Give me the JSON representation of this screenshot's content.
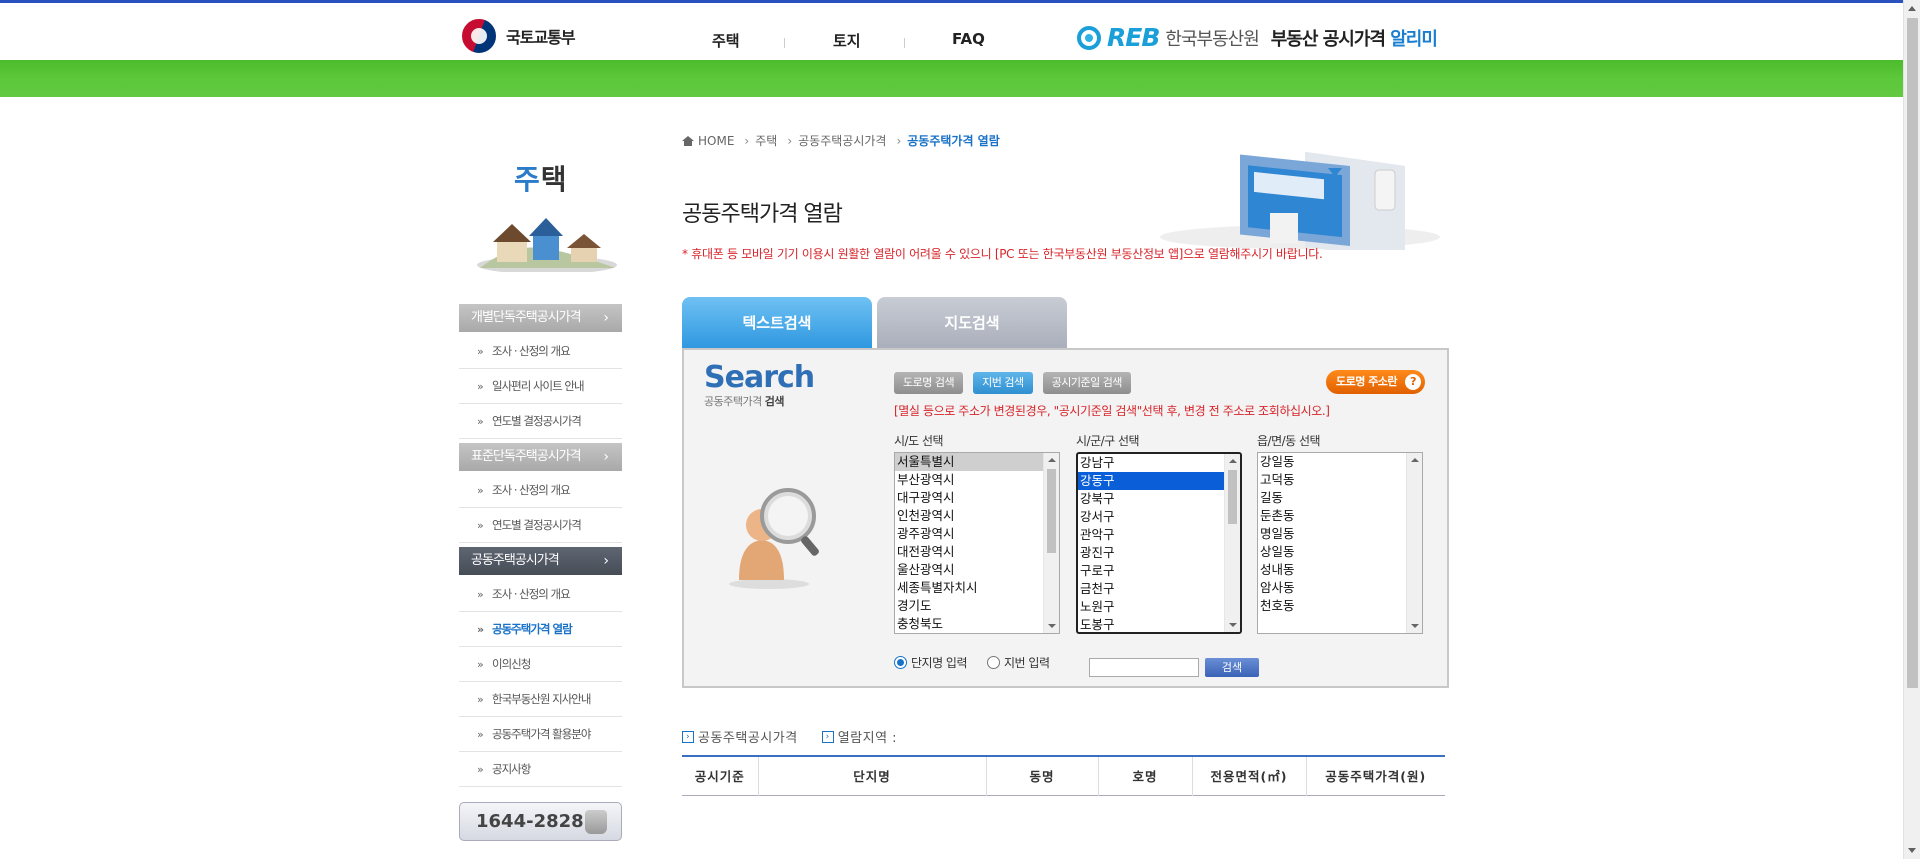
{
  "header": {
    "ministry_name": "국토교통부",
    "nav": [
      "주택",
      "토지",
      "FAQ"
    ],
    "reb_mark": "REB",
    "reb_korean": "한국부동산원",
    "service_title_prefix": "부동산 공시가격",
    "service_title_suffix": "알리미"
  },
  "sidebar": {
    "title_first": "주",
    "title_rest": "택",
    "groups": [
      {
        "label": "개별단독주택공시가격",
        "active": false,
        "items": [
          "조사 · 산정의 개요",
          "일사편리 사이트 안내",
          "연도별 결정공시가격"
        ]
      },
      {
        "label": "표준단독주택공시가격",
        "active": false,
        "items": [
          "조사 · 산정의 개요",
          "연도별 결정공시가격"
        ]
      },
      {
        "label": "공동주택공시가격",
        "active": true,
        "items": [
          "조사 · 산정의 개요",
          "공동주택가격 열람",
          "이의신청",
          "한국부동산원 지사안내",
          "공동주택가격 활용분야",
          "공지사항"
        ]
      }
    ],
    "phone": "1644-2828"
  },
  "breadcrumb": {
    "home": "HOME",
    "level1": "주택",
    "level2": "공동주택공시가격",
    "current": "공동주택가격 열람"
  },
  "main": {
    "title": "공동주택가격 열람",
    "notice": "* 휴대폰 등 모바일 기기 이용시 원활한 열람이 어려울 수 있으니 [PC 또는 한국부동산원 부동산정보 앱]으로 열람해주시기 바랍니다.",
    "tabs": [
      "텍스트검색",
      "지도검색"
    ]
  },
  "search": {
    "logo_big": "Search",
    "logo_small_plain": "공동주택가격 ",
    "logo_small_bold": "검색",
    "buttons": [
      "도로명 검색",
      "지번 검색",
      "공시기준일 검색"
    ],
    "road_button": "도로명 주소란",
    "warning": "[멸실 등으로 주소가 변경된경우, \"공시기준일 검색\"선택 후, 변경 전 주소로 조회하십시오.]",
    "col1_label": "시/도 선택",
    "col2_label": "시/군/구 선택",
    "col3_label": "읍/면/동 선택",
    "sido": [
      "서울특별시",
      "부산광역시",
      "대구광역시",
      "인천광역시",
      "광주광역시",
      "대전광역시",
      "울산광역시",
      "세종특별자치시",
      "경기도",
      "충청북도"
    ],
    "sigungu": [
      "강남구",
      "강동구",
      "강북구",
      "강서구",
      "관악구",
      "광진구",
      "구로구",
      "금천구",
      "노원구",
      "도봉구"
    ],
    "dong": [
      "강일동",
      "고덕동",
      "길동",
      "둔촌동",
      "명일동",
      "상일동",
      "성내동",
      "암사동",
      "천호동"
    ],
    "radio1": "단지명 입력",
    "radio2": "지번 입력",
    "input_value": "",
    "go_button": "검색"
  },
  "results": {
    "head1": "공동주택공시가격",
    "head2": "열람지역 :",
    "columns": [
      "공시기준",
      "단지명",
      "동명",
      "호명",
      "전용면적(㎡)",
      "공동주택가격(원)"
    ]
  }
}
